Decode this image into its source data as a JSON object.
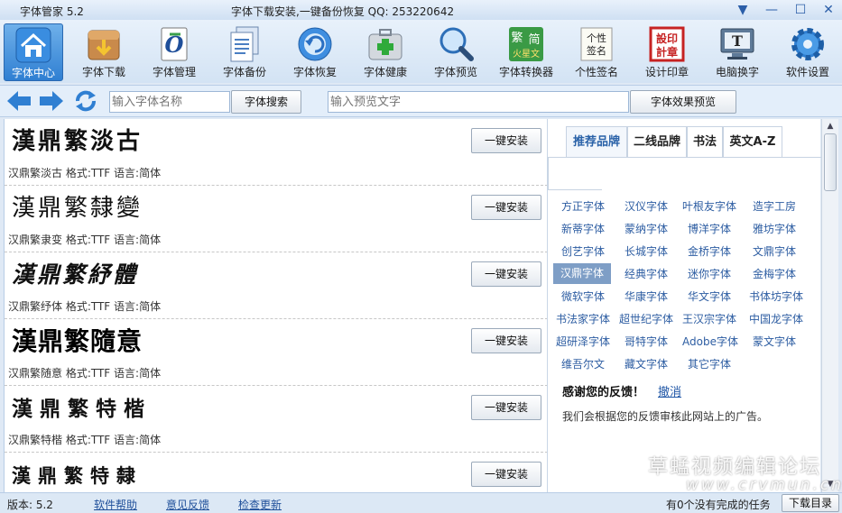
{
  "window": {
    "title": "字体管家 5.2",
    "slogan": "字体下载安装,一键备份恢复 QQ: 253220642",
    "controls": {
      "dropdown": "▼",
      "minimize": "—",
      "maximize": "☐",
      "close": "✕"
    }
  },
  "toolbar": {
    "items": [
      {
        "label": "字体中心",
        "icon": "home-icon"
      },
      {
        "label": "字体下载",
        "icon": "download-box-icon"
      },
      {
        "label": "字体管理",
        "icon": "font-manage-icon"
      },
      {
        "label": "字体备份",
        "icon": "document-backup-icon"
      },
      {
        "label": "字体恢复",
        "icon": "restore-icon"
      },
      {
        "label": "字体健康",
        "icon": "medkit-icon"
      },
      {
        "label": "字体预览",
        "icon": "magnifier-icon"
      },
      {
        "label": "字体转换器",
        "icon": "converter-icon",
        "icon_text": [
          "繁",
          "简",
          "火星文"
        ]
      },
      {
        "label": "个性签名",
        "icon": "signature-icon",
        "icon_text": [
          "个性",
          "签名"
        ]
      },
      {
        "label": "设计印章",
        "icon": "seal-icon",
        "icon_text": [
          "設印",
          "計章"
        ]
      },
      {
        "label": "电脑换字",
        "icon": "monitor-icon",
        "icon_text": "T"
      },
      {
        "label": "软件设置",
        "icon": "gear-icon"
      }
    ]
  },
  "search": {
    "font_name_placeholder": "输入字体名称",
    "search_button": "字体搜索",
    "preview_placeholder": "输入预览文字",
    "preview_button": "字体效果预览"
  },
  "fonts": [
    {
      "sample": "漢鼎繁淡古",
      "info": "汉鼎繁淡古  格式:TTF 语言:简体",
      "button": "一键安装"
    },
    {
      "sample": "漢鼎繁隸變",
      "info": "汉鼎繁隶变  格式:TTF 语言:简体",
      "button": "一键安装"
    },
    {
      "sample": "漢鼎繁紓體",
      "info": "汉鼎繁纾体  格式:TTF 语言:简体",
      "button": "一键安装"
    },
    {
      "sample": "漢鼎繁隨意",
      "info": "汉鼎繁随意  格式:TTF 语言:简体",
      "button": "一键安装"
    },
    {
      "sample": "漢鼎繁特楷",
      "info": "汉鼎繁特楷  格式:TTF 语言:简体",
      "button": "一键安装"
    },
    {
      "sample": "漢鼎繁特隸",
      "info": "",
      "button": "一键安装"
    }
  ],
  "right_panel": {
    "tabs": [
      "推荐品牌",
      "二线品牌",
      "书法",
      "英文A-Z"
    ],
    "brands": [
      "方正字体",
      "汉仪字体",
      "叶根友字体",
      "造字工房",
      "新蒂字体",
      "蒙纳字体",
      "博洋字体",
      "雅坊字体",
      "创艺字体",
      "长城字体",
      "金桥字体",
      "文鼎字体",
      "汉鼎字体",
      "经典字体",
      "迷你字体",
      "金梅字体",
      "微软字体",
      "华康字体",
      "华文字体",
      "书体坊字体",
      "书法家字体",
      "超世纪字体",
      "王汉宗字体",
      "中国龙字体",
      "超研泽字体",
      "哥特字体",
      "Adobe字体",
      "蒙文字体",
      "维吾尔文",
      "藏文字体",
      "其它字体"
    ],
    "selected_brand": "汉鼎字体",
    "thanks": "感谢您的反馈！",
    "cancel": "撤消",
    "notice": "我们会根据您的反馈审核此网站上的广告。"
  },
  "watermark": {
    "line1": "草蜢视频编辑论坛",
    "line2": "www.crvmun.cn"
  },
  "status": {
    "version": "版本: 5.2",
    "help": "软件帮助",
    "feedback": "意见反馈",
    "update": "检查更新",
    "tasks": "有0个没有完成的任务",
    "download_dir": "下载目录"
  },
  "colors": {
    "accent": "#2f7fd2",
    "link": "#1f4f9a",
    "selected_brand_bg": "#7e9ec6"
  }
}
